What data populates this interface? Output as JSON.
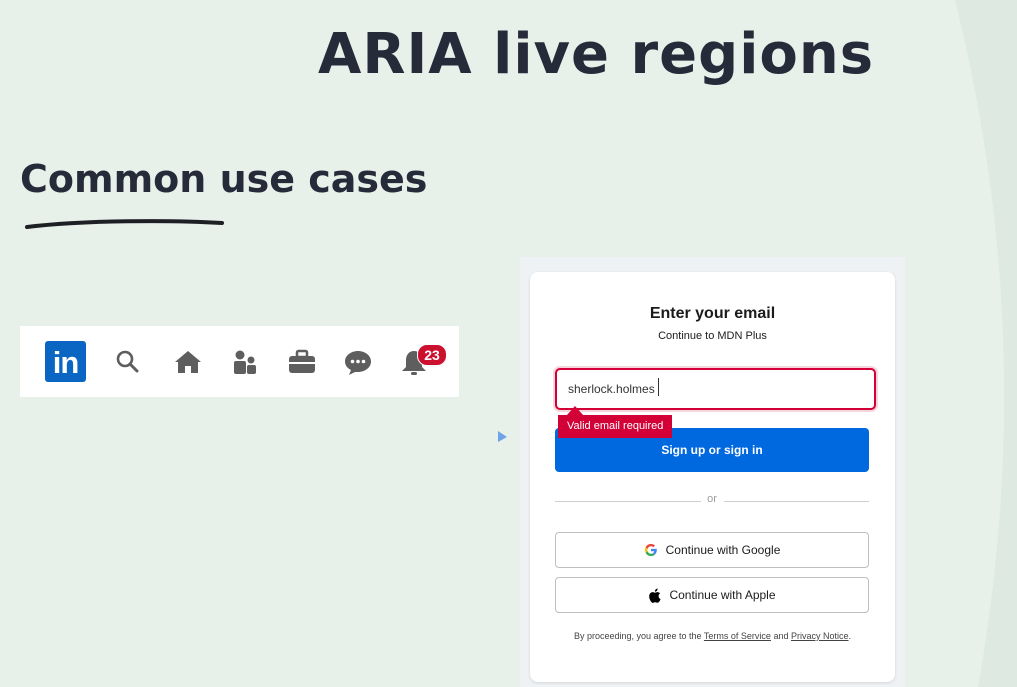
{
  "slide": {
    "title": "ARIA live regions",
    "section_heading": "Common use cases"
  },
  "linkedin_bar": {
    "logo_text": "in",
    "icons": [
      "search-icon",
      "home-icon",
      "people-icon",
      "briefcase-icon",
      "messaging-icon",
      "bell-icon"
    ],
    "notification_count": "23",
    "colors": {
      "brand": "#0a66c2",
      "badge": "#cb112d",
      "icon": "#5e5e5e"
    }
  },
  "signin": {
    "title": "Enter your email",
    "subtitle": "Continue to MDN Plus",
    "email_value": "sherlock.holmes",
    "error_message": "Valid email required",
    "primary_button": "Sign up or sign in",
    "divider_text": "or",
    "google_button": "Continue with Google",
    "apple_button": "Continue with Apple",
    "legal_prefix": "By proceeding, you agree to the",
    "terms_link": "Terms of Service",
    "legal_and": "and",
    "privacy_link": "Privacy Notice",
    "legal_suffix": ".",
    "colors": {
      "error": "#d30038",
      "primary": "#0069e0"
    }
  }
}
